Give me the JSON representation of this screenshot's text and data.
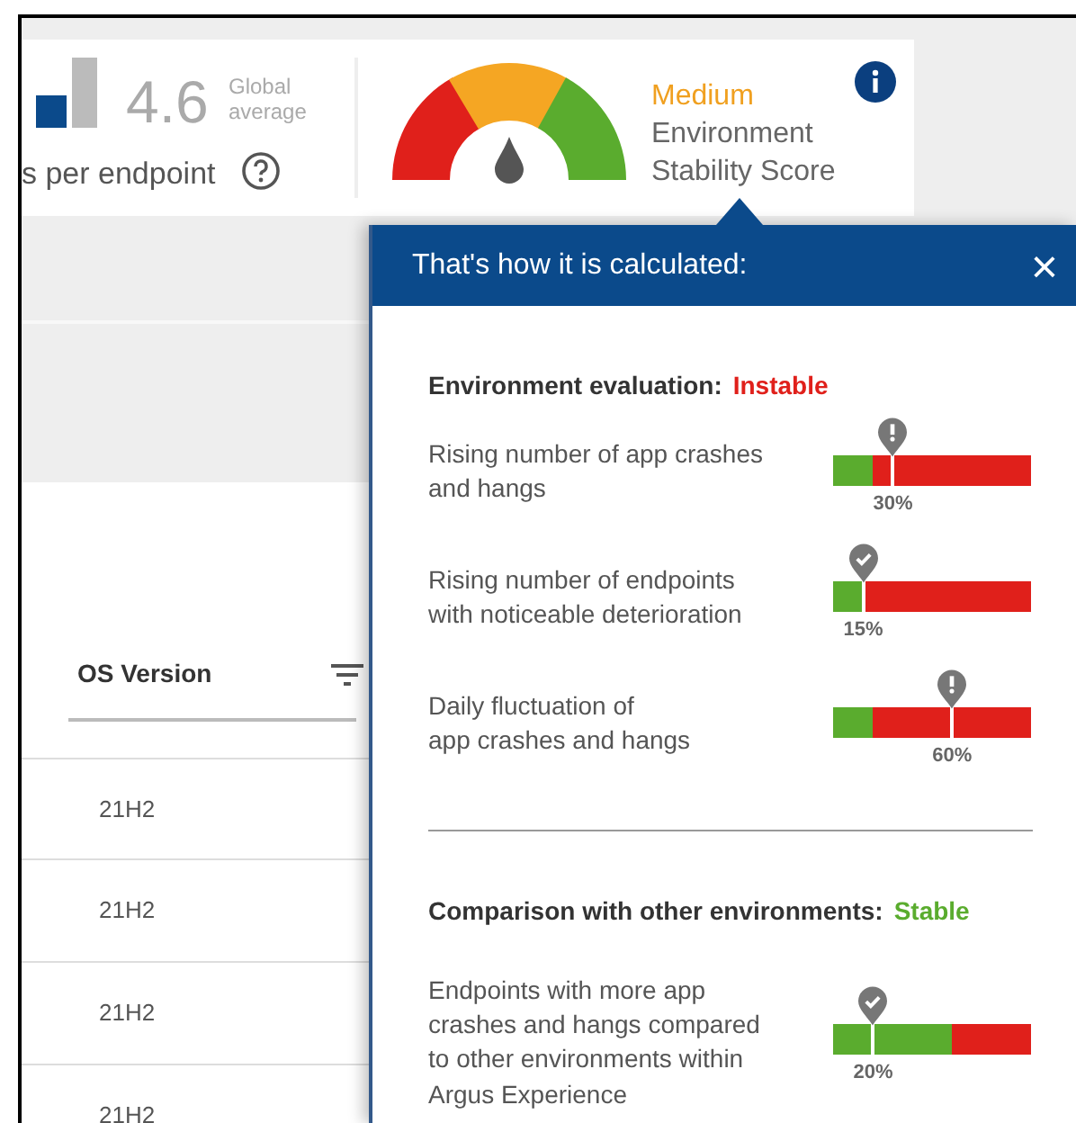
{
  "summary": {
    "value": "4.6",
    "caption": "Global average",
    "label": "s per endpoint"
  },
  "stability": {
    "rating": "Medium",
    "label": "Environment Stability Score"
  },
  "table": {
    "columns": [
      {
        "label": "OS Version"
      }
    ],
    "rows": [
      [
        "21H2"
      ],
      [
        "21H2"
      ],
      [
        "21H2"
      ],
      [
        "21H2"
      ]
    ]
  },
  "popup": {
    "title": "That's how it is calculated:",
    "close": "×",
    "sections": [
      {
        "title": "Environment evaluation:",
        "verdict": "Instable",
        "color": "#e0201b",
        "factors": [
          {
            "lines": [
              "Rising number of app crashes",
              "and hangs"
            ],
            "level": 0.3,
            "reading": "30%",
            "kind": "alert",
            "safe_zone": {
              "level": 0.2
            }
          },
          {
            "lines": [
              "Rising number of endpoints",
              "with noticeable deterioration"
            ],
            "level": 0.15,
            "reading": "15%",
            "kind": "ok",
            "safe_zone": {
              "level": 0.14
            }
          },
          {
            "lines": [
              "Daily fluctuation of",
              "app crashes and hangs"
            ],
            "level": 0.6,
            "reading": "60%",
            "kind": "alert",
            "safe_zone": {
              "level": 0.2
            }
          }
        ]
      },
      {
        "title": "Comparison with other environments:",
        "verdict": "Stable",
        "color": "#5aac2e",
        "factors": [
          {
            "lines": [
              "Endpoints with more app",
              "crashes and hangs compared",
              "to other environments within",
              "Argus Experience"
            ],
            "level": 0.2,
            "reading": "20%",
            "kind": "ok",
            "safe_zone": {
              "level": 0.6
            }
          }
        ]
      }
    ]
  }
}
